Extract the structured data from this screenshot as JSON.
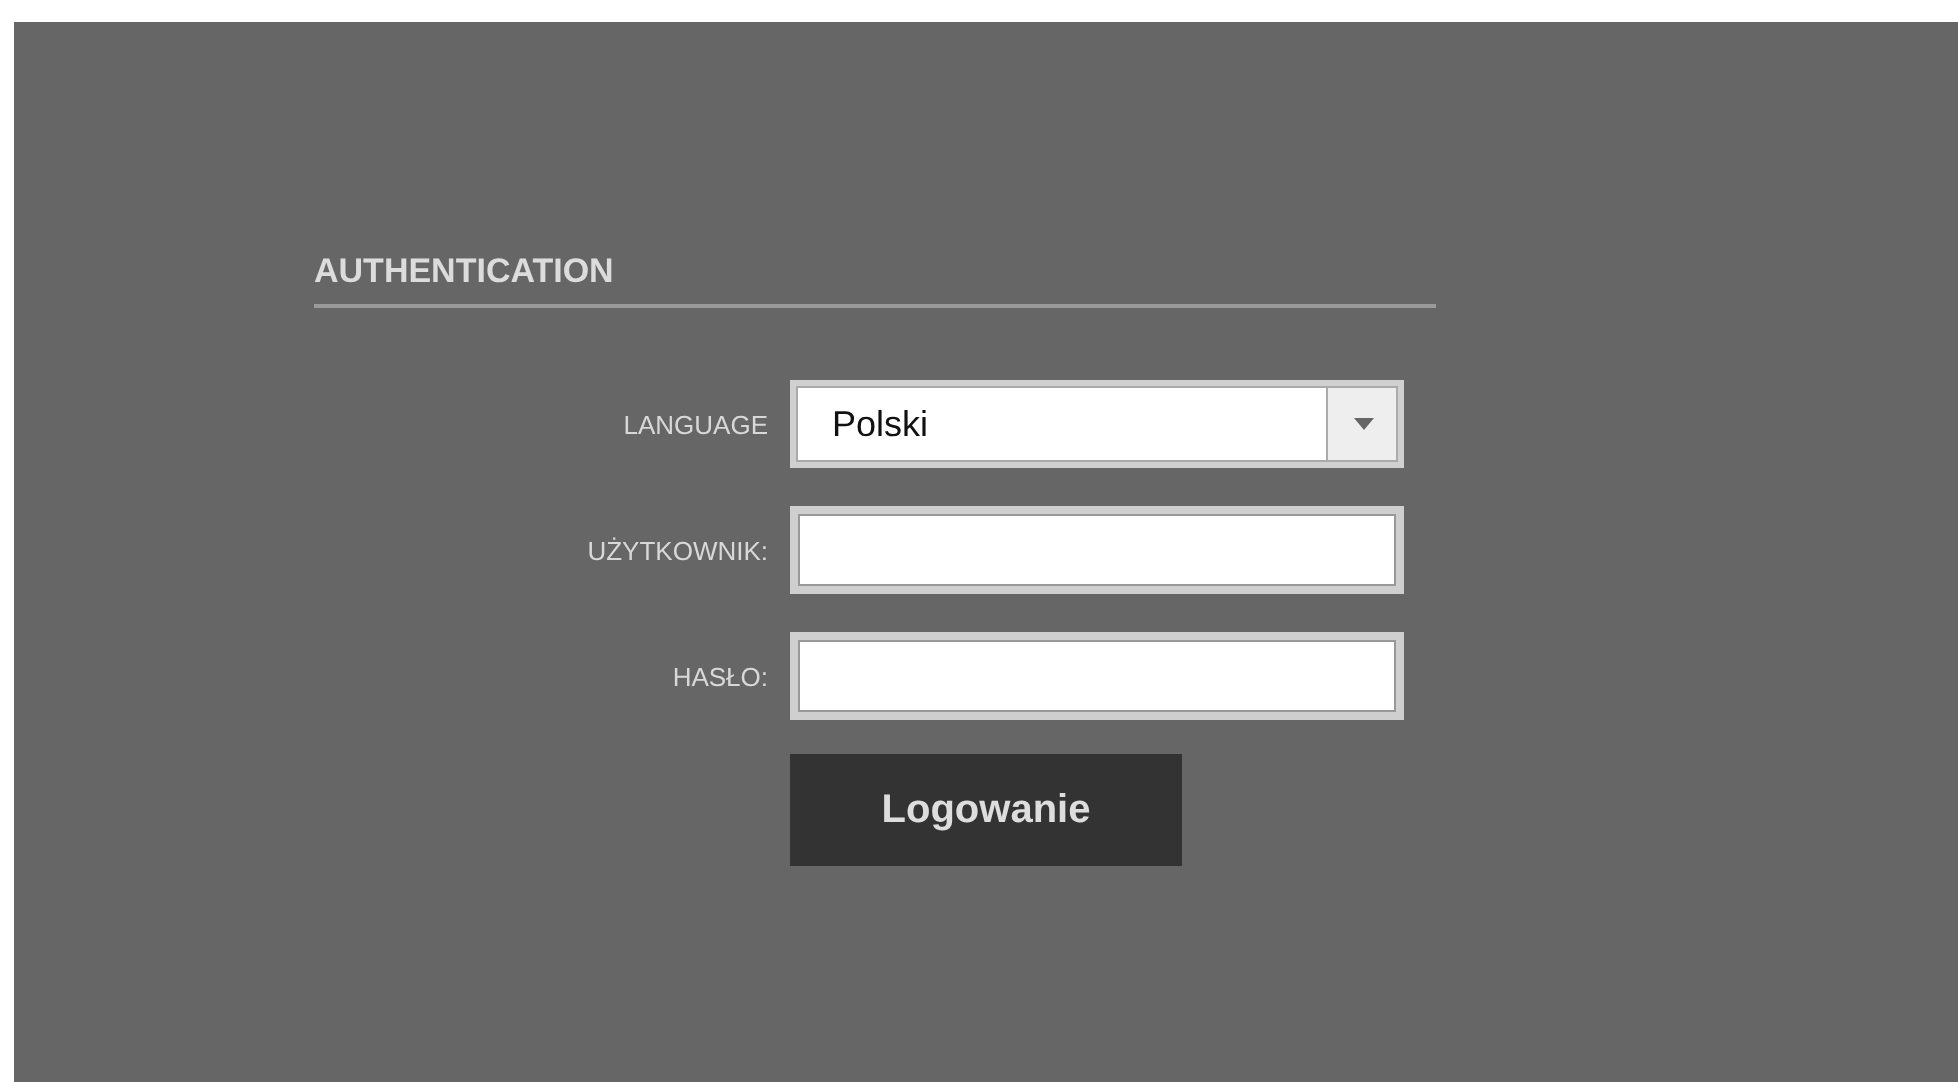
{
  "heading": "AUTHENTICATION",
  "fields": [
    {
      "kind": "select",
      "label": "LANGUAGE",
      "value": "Polski"
    },
    {
      "kind": "text",
      "label": "UŻYTKOWNIK:"
    },
    {
      "kind": "password",
      "label": "HASŁO:"
    }
  ],
  "button": "Logowanie"
}
